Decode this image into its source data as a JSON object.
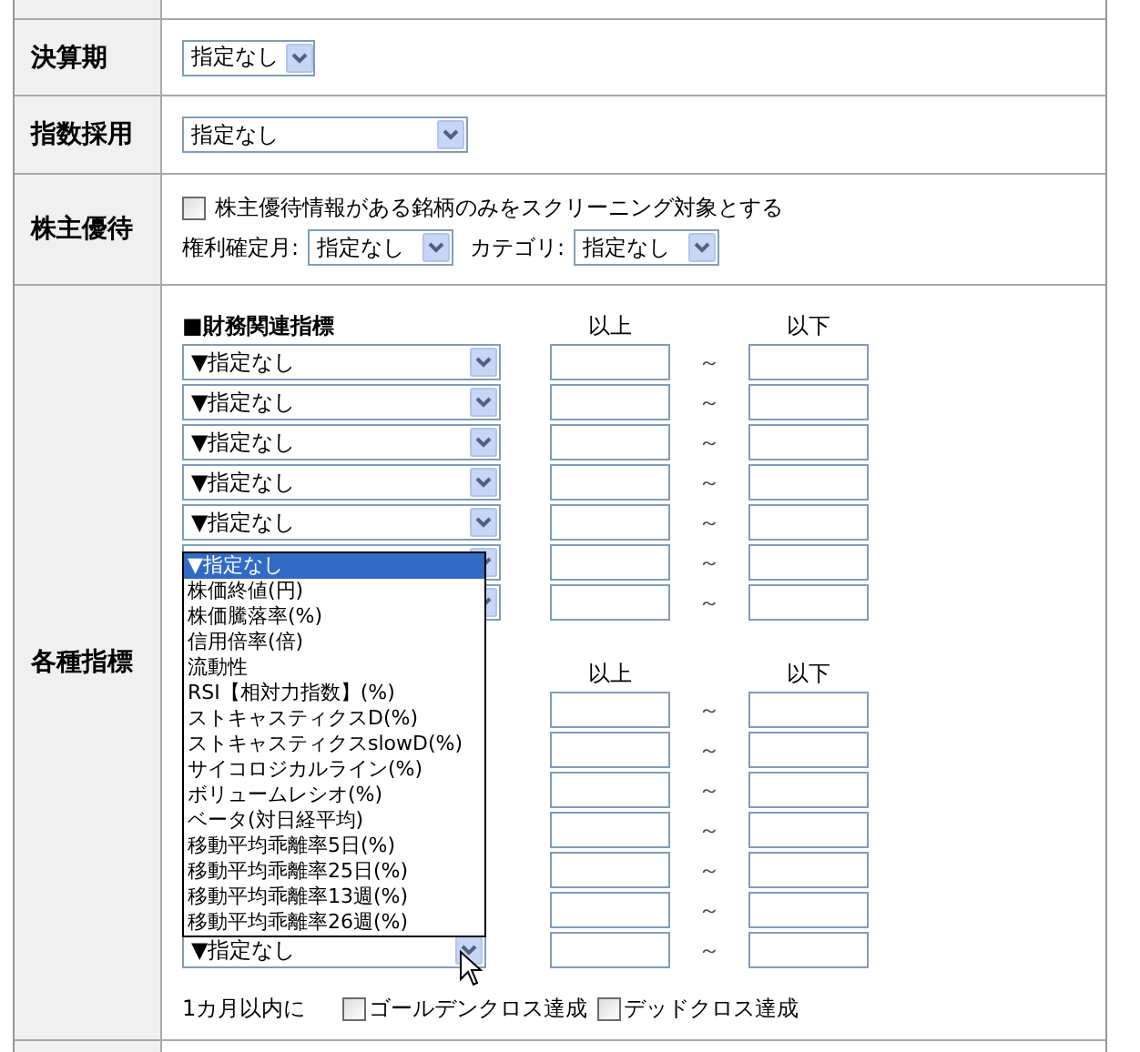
{
  "fields": [
    {
      "kind": "select",
      "label": "決算期",
      "value": "指定なし"
    },
    {
      "kind": "select",
      "label": "指数採用",
      "value": "指定なし"
    },
    {
      "kind": "benefit",
      "label": "株主優待",
      "checkbox": {
        "label": "株主優待情報がある銘柄のみをスクリーニング対象とする",
        "checked": false
      },
      "month_label": "権利確定月:",
      "month_value": "指定なし",
      "category_label": "カテゴリ:",
      "category_value": "指定なし"
    },
    {
      "kind": "indicators",
      "label": "各種指標",
      "sections": [
        {
          "heading": "■財務関連指標",
          "min_label": "以上",
          "max_label": "以下",
          "rows": [
            {
              "kind": "select",
              "value": "▼指定なし",
              "tilde": "～"
            },
            {
              "kind": "select",
              "value": "▼指定なし",
              "tilde": "～"
            },
            {
              "kind": "select",
              "value": "▼指定なし",
              "tilde": "～"
            },
            {
              "kind": "select",
              "value": "▼指定なし",
              "tilde": "～"
            },
            {
              "kind": "select",
              "value": "▼指定なし",
              "tilde": "～"
            },
            {
              "kind": "covered",
              "tilde": "～"
            },
            {
              "kind": "covered",
              "tilde": "～"
            }
          ]
        },
        {
          "min_label": "以上",
          "max_label": "以下",
          "rows": [
            {
              "kind": "hidden",
              "tilde": "～"
            },
            {
              "kind": "hidden",
              "tilde": "～"
            },
            {
              "kind": "hidden",
              "tilde": "～"
            },
            {
              "kind": "hidden",
              "tilde": "～"
            },
            {
              "kind": "hidden",
              "tilde": "～"
            },
            {
              "kind": "hidden",
              "tilde": "～"
            },
            {
              "kind": "select",
              "value": "▼指定なし",
              "tilde": "～"
            }
          ]
        }
      ],
      "dropdown": {
        "items": [
          {
            "label": "▼指定なし",
            "selected": true
          },
          {
            "label": "株価終値(円)",
            "selected": false
          },
          {
            "label": "株価騰落率(%)",
            "selected": false
          },
          {
            "label": "信用倍率(倍)",
            "selected": false
          },
          {
            "label": "流動性",
            "selected": false
          },
          {
            "label": "RSI【相対力指数】(%)",
            "selected": false
          },
          {
            "label": "ストキャスティクスD(%)",
            "selected": false
          },
          {
            "label": "ストキャスティクスslowD(%)",
            "selected": false
          },
          {
            "label": "サイコロジカルライン(%)",
            "selected": false
          },
          {
            "label": "ボリュームレシオ(%)",
            "selected": false
          },
          {
            "label": "ベータ(対日経平均)",
            "selected": false
          },
          {
            "label": "移動平均乖離率5日(%)",
            "selected": false
          },
          {
            "label": "移動平均乖離率25日(%)",
            "selected": false
          },
          {
            "label": "移動平均乖離率13週(%)",
            "selected": false
          },
          {
            "label": "移動平均乖離率26週(%)",
            "selected": false
          }
        ]
      },
      "footer": {
        "label": "1カ月以内に",
        "options": [
          {
            "label": "ゴールデンクロス達成",
            "checked": false
          },
          {
            "label": "デッドクロス達成",
            "checked": false
          }
        ]
      }
    }
  ]
}
